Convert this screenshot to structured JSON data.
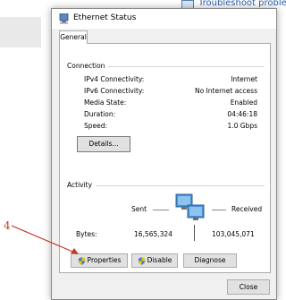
{
  "background": {
    "link_text": "Troubleshoot problems"
  },
  "annotation": {
    "marker": "4"
  },
  "window": {
    "title": "Ethernet Status",
    "tab": "General",
    "connection": {
      "group_label": "Connection",
      "rows": [
        {
          "label": "IPv4 Connectivity:",
          "value": "Internet"
        },
        {
          "label": "IPv6 Connectivity:",
          "value": "No Internet access"
        },
        {
          "label": "Media State:",
          "value": "Enabled"
        },
        {
          "label": "Duration:",
          "value": "04:46:18"
        },
        {
          "label": "Speed:",
          "value": "1.0 Gbps"
        }
      ],
      "details_button": "Details..."
    },
    "activity": {
      "group_label": "Activity",
      "sent_label": "Sent",
      "received_label": "Received",
      "bytes_label": "Bytes:",
      "bytes_sent": "16,565,324",
      "bytes_received": "103,045,071"
    },
    "buttons": {
      "properties": "Properties",
      "disable": "Disable",
      "diagnose": "Diagnose",
      "close": "Close"
    }
  },
  "colors": {
    "annotation": "#c0392b",
    "link": "#2a5fb0"
  }
}
